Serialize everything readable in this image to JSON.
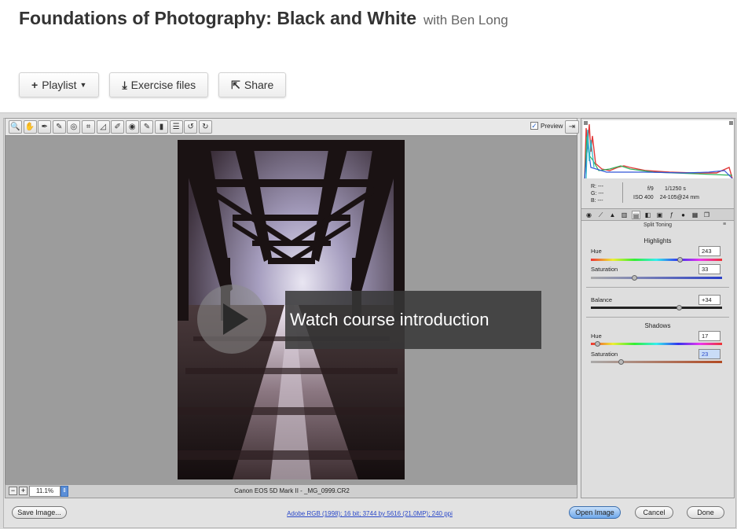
{
  "header": {
    "title": "Foundations of Photography: Black and White",
    "author": "with Ben Long"
  },
  "actions": {
    "playlist": "Playlist",
    "exercise_files": "Exercise files",
    "share": "Share"
  },
  "toolbar": {
    "tools": [
      "zoom-icon",
      "hand-icon",
      "eyedropper-icon",
      "color-sampler-icon",
      "target-adjust-icon",
      "crop-icon",
      "straighten-icon",
      "spot-removal-icon",
      "red-eye-icon",
      "brush-icon",
      "gradient-icon",
      "prefs-icon",
      "rotate-ccw-icon",
      "rotate-cw-icon"
    ],
    "preview_label": "Preview"
  },
  "statusbar": {
    "zoom": "11.1%",
    "filename": "Canon EOS 5D Mark II  -  _MG_0999.CR2"
  },
  "panel": {
    "rgb": [
      "R:  ---",
      "G:  ---",
      "B:  ---"
    ],
    "aperture": "f/9",
    "shutter": "1/1250 s",
    "iso": "ISO 400",
    "lens": "24-105@24 mm",
    "title": "Split Toning",
    "highlights_title": "Highlights",
    "shadows_title": "Shadows",
    "highlights": {
      "hue_label": "Hue",
      "hue_value": "243",
      "hue_level": 0.675,
      "sat_label": "Saturation",
      "sat_value": "33",
      "sat_level": 0.33
    },
    "balance": {
      "label": "Balance",
      "value": "+34",
      "level": 0.67
    },
    "shadows": {
      "hue_label": "Hue",
      "hue_value": "17",
      "hue_level": 0.047,
      "sat_label": "Saturation",
      "sat_value": "23",
      "sat_level": 0.23
    }
  },
  "bottom": {
    "save_image": "Save Image...",
    "workflow_link": "Adobe RGB (1998); 16 bit; 3744 by 5616 (21.0MP); 240 ppi",
    "open_image": "Open Image",
    "cancel": "Cancel",
    "done": "Done"
  },
  "overlay": {
    "text": "Watch course introduction"
  },
  "colors": {
    "accent_blue": "#6fa8ea",
    "overlay_bg": "#373737"
  }
}
